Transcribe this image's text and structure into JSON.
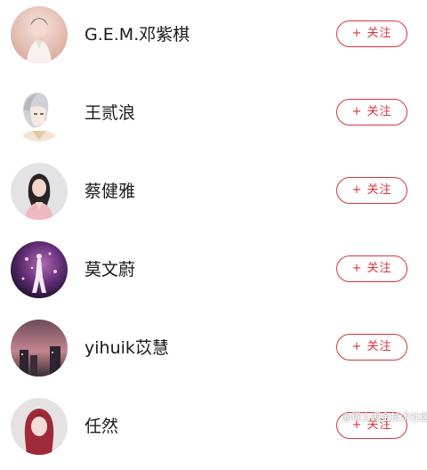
{
  "follow_label": "+ 关注",
  "users": [
    {
      "name": "G.E.M.邓紫棋",
      "avatar": "avatar-gem",
      "button": "+ 关注"
    },
    {
      "name": "王贰浪",
      "avatar": "avatar-cartoon",
      "button": "+ 关注"
    },
    {
      "name": "蔡健雅",
      "avatar": "avatar-girl-pink",
      "button": "+ 关注"
    },
    {
      "name": "莫文蔚",
      "avatar": "avatar-stage-purple",
      "button": "+ 关注"
    },
    {
      "name": "yihuik苡慧",
      "avatar": "avatar-dusk",
      "button": "+ 关注"
    },
    {
      "name": "任然",
      "avatar": "avatar-redhair",
      "button": "+ 关注"
    }
  ],
  "watermark": "@稀土掘金技术社区",
  "colors": {
    "accent": "#d8333a",
    "text": "#1a1a1a",
    "background": "#ffffff"
  }
}
